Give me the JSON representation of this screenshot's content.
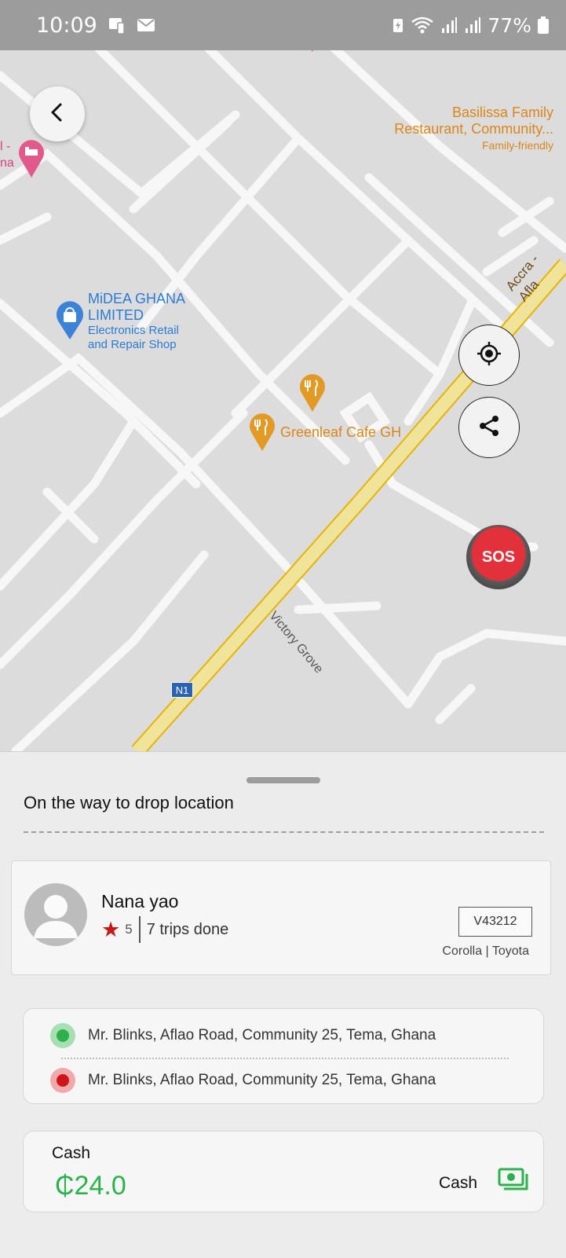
{
  "status_bar": {
    "time": "10:09",
    "battery": "77%"
  },
  "map": {
    "labels": {
      "basilissa_line1": "Basilissa Family",
      "basilissa_line2": "Restaurant, Community...",
      "basilissa_sub": "Family-friendly",
      "midea_line1": "MiDEA GHANA",
      "midea_line2": "LIMITED",
      "midea_sub_line1": "Electronics Retail",
      "midea_sub_line2": "and Repair Shop",
      "greenleaf": "Greenleaf Cafe GH",
      "road_accra": "Accra - Afla",
      "road_victory": "Victory Grove",
      "route_shield": "N1",
      "left_partial_1": "l -",
      "left_partial_2": "na"
    },
    "sos_label": "SOS"
  },
  "sheet": {
    "title": "On the way to drop location",
    "driver": {
      "name": "Nana yao",
      "rating": "5",
      "trips": "7 trips done",
      "plate": "V43212",
      "car": "Corolla | Toyota"
    },
    "route": {
      "pickup": "Mr. Blinks, Aflao Road, Community 25, Tema, Ghana",
      "drop": "Mr. Blinks, Aflao Road, Community 25, Tema, Ghana"
    },
    "payment": {
      "title": "Cash",
      "amount": "₵24.0",
      "method": "Cash"
    }
  },
  "colors": {
    "pickup": "#2bb24c",
    "drop": "#d0151a",
    "sos": "#e3313c",
    "accent_green": "#2bb24c"
  },
  "icons": [
    "back-arrow-icon",
    "my-location-icon",
    "share-icon",
    "cash-icon",
    "star-icon",
    "user-avatar-icon"
  ]
}
